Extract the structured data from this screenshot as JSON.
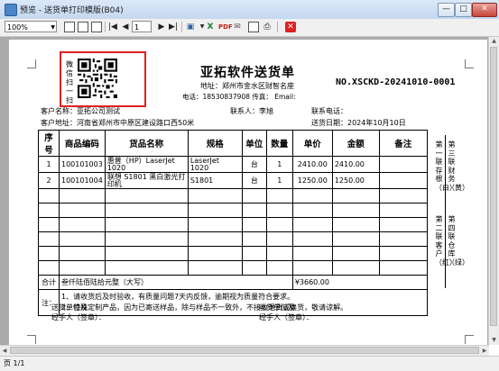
{
  "window": {
    "title": "预览 - 送货单打印模版(B04)",
    "min": "—",
    "max": "□",
    "close": "✕"
  },
  "toolbar": {
    "zoom": "100%",
    "page": "1",
    "icons": [
      "one-page-icon",
      "two-page-icon",
      "multi-page-icon",
      "first-page-icon",
      "prev-page-icon",
      "next-page-icon",
      "last-page-icon",
      "save-icon",
      "excel-icon",
      "pdf-icon",
      "email-icon",
      "page-setup-icon",
      "print-icon",
      "close-icon"
    ]
  },
  "status": {
    "page_count": "页 1/1"
  },
  "doc": {
    "qr_label": "微信扫一扫",
    "company": "亚拓软件送货单",
    "address": "地址：郑州市金水区财智名座",
    "phone_line": "电话：18530837908  传真：  Email:",
    "doc_no": "NO.XSCKD-20241010-0001",
    "customer_name": "客户名称：亚拓公司测试",
    "contact": "联系人：李旭",
    "contact_phone": "联系电话：",
    "customer_addr": "客户地址：河南省郑州市中原区建设路口西50米",
    "delivery_date": "送货日期：2024年10月10日",
    "headers": [
      "序号",
      "商品编码",
      "货品名称",
      "规格",
      "单位",
      "数量",
      "单价",
      "金额",
      "备注"
    ],
    "rows": [
      [
        "1",
        "100101003",
        "惠普（HP）LaserJet 1020",
        "LaserJet 1020",
        "台",
        "1",
        "2410.00",
        "2410.00",
        ""
      ],
      [
        "2",
        "100101004",
        "联想 S1801 黑白激光打印机",
        "S1801",
        "台",
        "1",
        "1250.00",
        "1250.00",
        ""
      ]
    ],
    "total_label": "合计",
    "total_words": "叁仟陆佰陆拾元整（大写）",
    "total_amount": "¥3660.00",
    "note_label": "注：",
    "note_1": "1、请收货后及时验收，有质量问题7天内反馈，逾期视为质量符合要求。",
    "note_2": "2、特殊定制产品，因为已寄送样品，除与样品不一致外，不接收退货或换货，敬请谅解。",
    "side_1": "第一联存根（白）",
    "side_2": "第二联客户（红）",
    "side_3": "第三联财务（黄）",
    "side_4": "第四联仓库（绿）",
    "sender_unit": "送货单位及",
    "sender_sign": "经手人（签章）：",
    "receiver_unit": "收货单位及",
    "receiver_sign": "经手人（签章）："
  }
}
